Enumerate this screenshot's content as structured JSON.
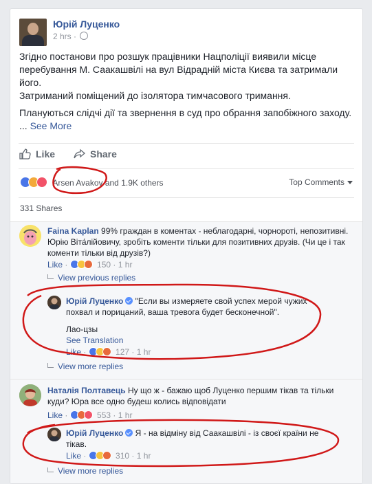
{
  "post": {
    "author": "Юрій Луценко",
    "time": "2 hrs",
    "privacy_separator": "·",
    "paragraphs": [
      "Згідно постанови про розшук працівники Нацполіції виявили місце перебування М. Саакашвілі на вул Відрадній міста Києва та затримали його.",
      "Затриманий поміщений до ізолятора тимчасового тримання.",
      "Плануються слідчі дії та звернення в суд про обрання запобіжного заходу."
    ],
    "see_more_prefix": "...",
    "see_more": "See More"
  },
  "actions": {
    "like": "Like",
    "share": "Share"
  },
  "reactions": {
    "names_highlight": "Arsen Avakov",
    "names_rest": " and 1.9K others",
    "sort_label": "Top Comments"
  },
  "shares": "331 Shares",
  "comments": [
    {
      "author": "Faina Kaplan",
      "text": " 99% граждан в коментах - неблагодарні, чорнороті, непозитивні. Юрію Віта́лійовичу, зробіть коменти тільки для позитивних друзів. (Чи це і так коменти тільки від друзів?)",
      "like": "Like",
      "sep": "·",
      "count": "150",
      "time": "1 hr",
      "view_replies": "View previous replies",
      "reply": {
        "author": "Юрій Луценко",
        "text": " \"Если вы измеряете свой успех мерой чужих похвал и порицаний, ваша тревога будет бесконечной\".",
        "signature": "Лао-цзы",
        "see_translation": "See Translation",
        "like": "Like",
        "count": "127",
        "time": "1 hr"
      },
      "view_more": "View more replies"
    },
    {
      "author": "Наталія Полтавець",
      "text": " Ну що ж - бажаю щоб Луценко першим тікав та тільки куди? Юра все одно будеш колись відповідати",
      "like": "Like",
      "count": "553",
      "time": "1 hr",
      "reply": {
        "author": "Юрій Луценко",
        "text": " Я - на відміну від Саакашвілі - із своєї країни не тікав.",
        "like": "Like",
        "count": "310",
        "time": "1 hr"
      },
      "view_more": "View more replies"
    }
  ],
  "colors": {
    "annotation": "#d01818",
    "link": "#365899"
  }
}
